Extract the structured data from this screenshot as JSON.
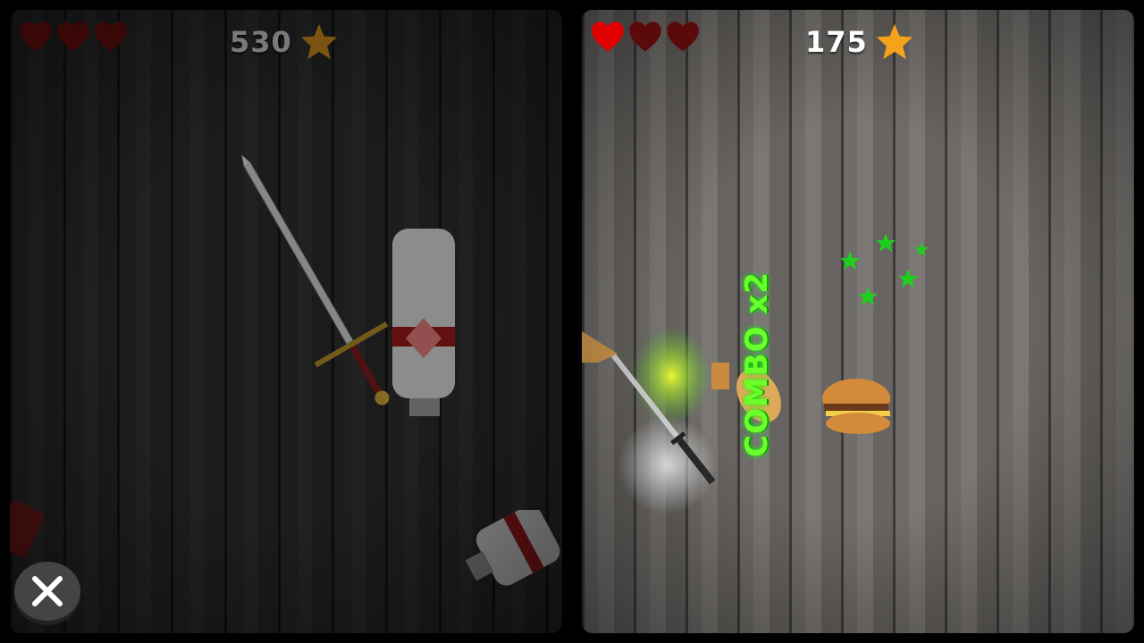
{
  "left_panel": {
    "lives": {
      "remaining": 0,
      "total": 3
    },
    "score": "530",
    "score_icon": "star-icon",
    "objects": [
      "sword",
      "fire-extinguisher",
      "fire-extinguisher-bottom"
    ],
    "close_icon": "close-icon"
  },
  "right_panel": {
    "lives": {
      "remaining": 1,
      "total": 3
    },
    "score": "175",
    "score_icon": "star-icon",
    "combo_text": "COMBO x2",
    "objects": [
      "katana",
      "sliced-food",
      "burger",
      "green-stars-burst"
    ]
  },
  "colors": {
    "heart_full": "#e10000",
    "heart_empty": "#5a0a0a",
    "star": "#f7a21b",
    "combo": "#6bff2b",
    "left_wood": "#2d2d2d",
    "right_wood": "#6f6c69"
  }
}
